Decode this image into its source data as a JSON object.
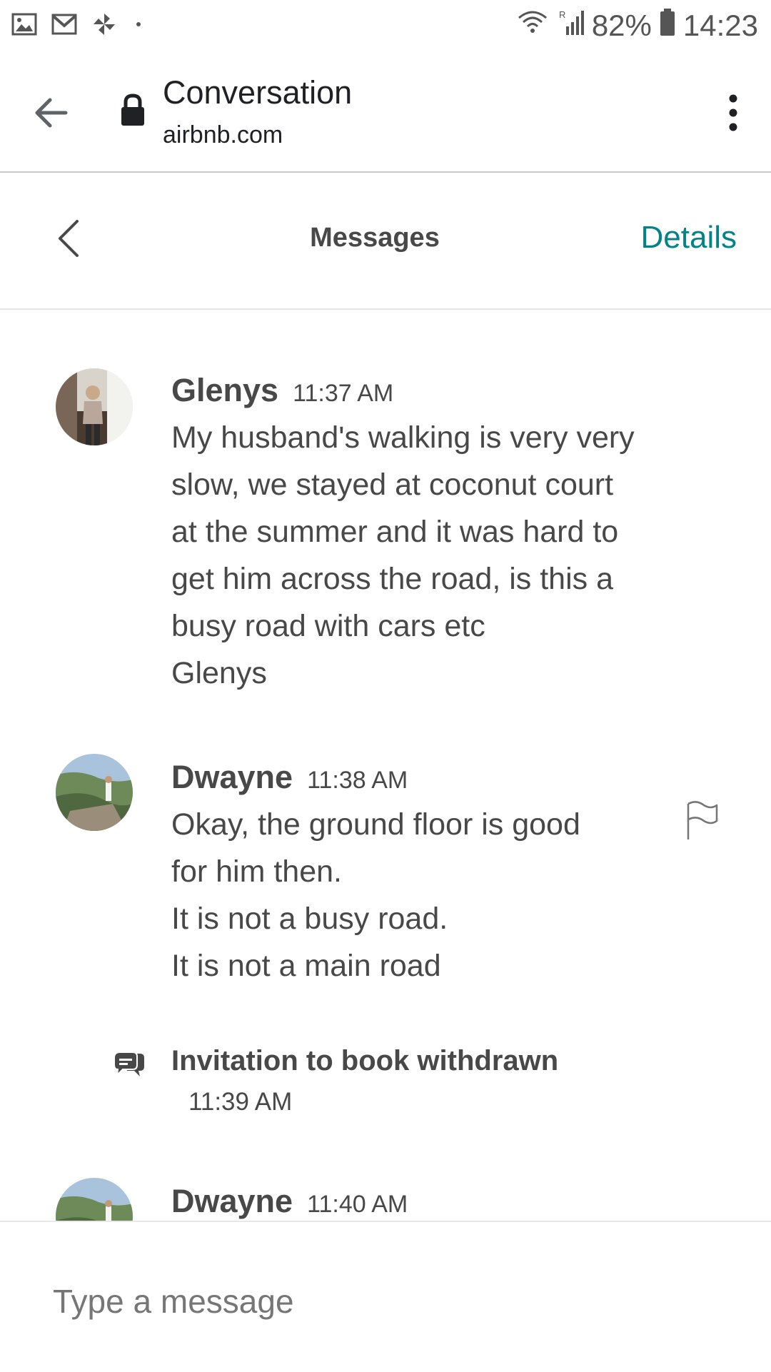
{
  "status_bar": {
    "battery": "82%",
    "time": "14:23",
    "icons": [
      "gallery-icon",
      "gmail-icon",
      "pinwheel-icon",
      "dot-icon",
      "wifi-icon",
      "signal-icon",
      "battery-icon"
    ]
  },
  "browser": {
    "title": "Conversation",
    "url": "airbnb.com"
  },
  "header": {
    "title": "Messages",
    "details_label": "Details",
    "accent_color": "#008489"
  },
  "messages": [
    {
      "sender": "Glenys",
      "time": "11:37 AM",
      "lines": [
        "My husband's walking is very very",
        "slow, we stayed at coconut court",
        "at the summer and it was hard to",
        "get him across the road, is this a",
        "busy road with cars etc",
        "Glenys"
      ]
    },
    {
      "sender": "Dwayne",
      "time": "11:38 AM",
      "lines": [
        "Okay, the ground floor is good",
        "for him then.",
        "It is not a busy road.",
        "It is not a main road"
      ]
    },
    {
      "sender": "Dwayne",
      "time": "11:40 AM",
      "lines": []
    }
  ],
  "system_event": {
    "text": "Invitation to book withdrawn",
    "time": "11:39 AM"
  },
  "composer": {
    "placeholder": "Type a message"
  }
}
